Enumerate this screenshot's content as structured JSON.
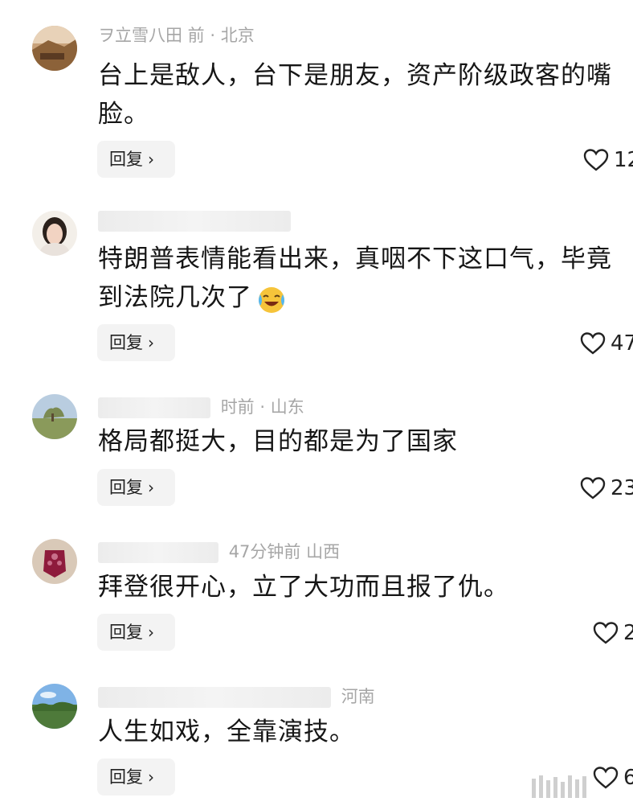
{
  "comments": [
    {
      "meta": "ヲ立雪八田   前 · 北京",
      "text": "台上是敌人，台下是朋友，资产阶级政客的嘴脸。",
      "reply_label": "回复",
      "likes": "12"
    },
    {
      "meta": "",
      "text": "特朗普表情能看出来，真咽不下这口气，毕竟到法院几次了",
      "reply_label": "回复",
      "likes": "47"
    },
    {
      "meta": "时前 · 山东",
      "text": "格局都挺大，目的都是为了国家",
      "reply_label": "回复",
      "likes": "23"
    },
    {
      "meta": "47分钟前  山西",
      "text": "拜登很开心，立了大功而且报了仇。",
      "reply_label": "回复",
      "likes": "2"
    },
    {
      "meta": "河南",
      "text": "人生如戏，全靠演技。",
      "reply_label": "回复",
      "likes": "6"
    }
  ],
  "icons": {
    "like": "heart-icon",
    "reply_chevron": "chevron-right-icon",
    "emoji": "crying-laughing-emoji-icon"
  },
  "colors": {
    "text": "#161616",
    "meta": "#a6a6a6",
    "reply_bg": "#f3f3f3"
  }
}
